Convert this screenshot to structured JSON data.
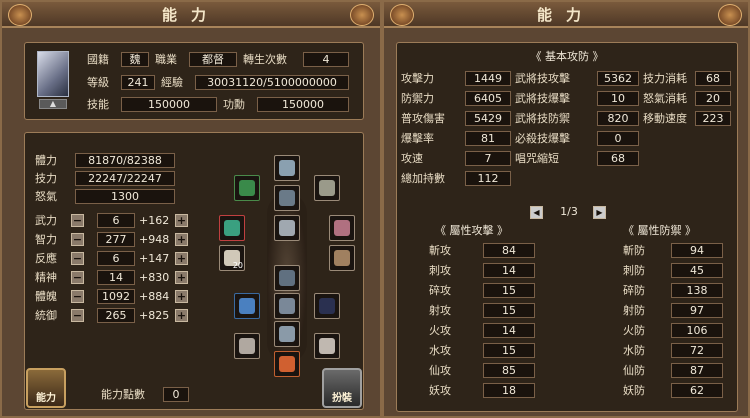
{
  "left": {
    "title": "能力",
    "profile": {
      "nation_label": "國籍",
      "nation": "魏",
      "job_label": "職業",
      "job": "都督",
      "rebirth_label": "轉生次數",
      "rebirth": "4",
      "level_label": "等級",
      "level": "241",
      "exp_label": "經驗",
      "exp": "30031120/5100000000",
      "skill_label": "技能",
      "skill": "150000",
      "merit_label": "功勳",
      "merit": "150000"
    },
    "vitals": [
      {
        "label": "體力",
        "value": "81870/82388"
      },
      {
        "label": "技力",
        "value": "22247/22247"
      },
      {
        "label": "怒氣",
        "value": "1300"
      }
    ],
    "stats": [
      {
        "label": "武力",
        "value": "6",
        "bonus": "+162"
      },
      {
        "label": "智力",
        "value": "277",
        "bonus": "+948"
      },
      {
        "label": "反應",
        "value": "6",
        "bonus": "+147"
      },
      {
        "label": "精神",
        "value": "14",
        "bonus": "+830"
      },
      {
        "label": "體魄",
        "value": "1092",
        "bonus": "+884"
      },
      {
        "label": "統御",
        "value": "265",
        "bonus": "+825"
      }
    ],
    "minus": "−",
    "plus": "+",
    "points_label": "能力點數",
    "points": "0",
    "btn_ability": "能力",
    "btn_dress": "扮裝",
    "slot_count": "20"
  },
  "right": {
    "title": "能力",
    "basic_header": "《 基本攻防 》",
    "basic": [
      [
        {
          "label": "攻擊力",
          "value": "1449"
        },
        {
          "label": "武將技攻擊",
          "value": "5362"
        },
        {
          "label": "技力消耗",
          "value": "68"
        }
      ],
      [
        {
          "label": "防禦力",
          "value": "6405"
        },
        {
          "label": "武將技爆擊",
          "value": "10"
        },
        {
          "label": "怒氣消耗",
          "value": "20"
        }
      ],
      [
        {
          "label": "普攻傷害",
          "value": "5429"
        },
        {
          "label": "武將技防禦",
          "value": "820"
        },
        {
          "label": "移動速度",
          "value": "223"
        }
      ],
      [
        {
          "label": "爆擊率",
          "value": "81"
        },
        {
          "label": "必殺技爆擊",
          "value": "0"
        }
      ],
      [
        {
          "label": "攻速",
          "value": "7"
        },
        {
          "label": "唱咒縮短",
          "value": "68"
        }
      ],
      [
        {
          "label": "總加持數",
          "value": "112"
        }
      ]
    ],
    "page": "1/3",
    "atk_header": "《 屬性攻擊 》",
    "def_header": "《 屬性防禦 》",
    "atk": [
      {
        "label": "斬攻",
        "value": "84"
      },
      {
        "label": "刺攻",
        "value": "14"
      },
      {
        "label": "碎攻",
        "value": "15"
      },
      {
        "label": "射攻",
        "value": "15"
      },
      {
        "label": "火攻",
        "value": "14"
      },
      {
        "label": "水攻",
        "value": "15"
      },
      {
        "label": "仙攻",
        "value": "85"
      },
      {
        "label": "妖攻",
        "value": "18"
      }
    ],
    "def": [
      {
        "label": "斬防",
        "value": "94"
      },
      {
        "label": "刺防",
        "value": "45"
      },
      {
        "label": "碎防",
        "value": "138"
      },
      {
        "label": "射防",
        "value": "97"
      },
      {
        "label": "火防",
        "value": "106"
      },
      {
        "label": "水防",
        "value": "72"
      },
      {
        "label": "仙防",
        "value": "87"
      },
      {
        "label": "妖防",
        "value": "62"
      }
    ]
  },
  "colors": {
    "panel": "#5c4633",
    "inner": "#2e2419",
    "box": "#1a130d",
    "border": "#9c7c58"
  }
}
